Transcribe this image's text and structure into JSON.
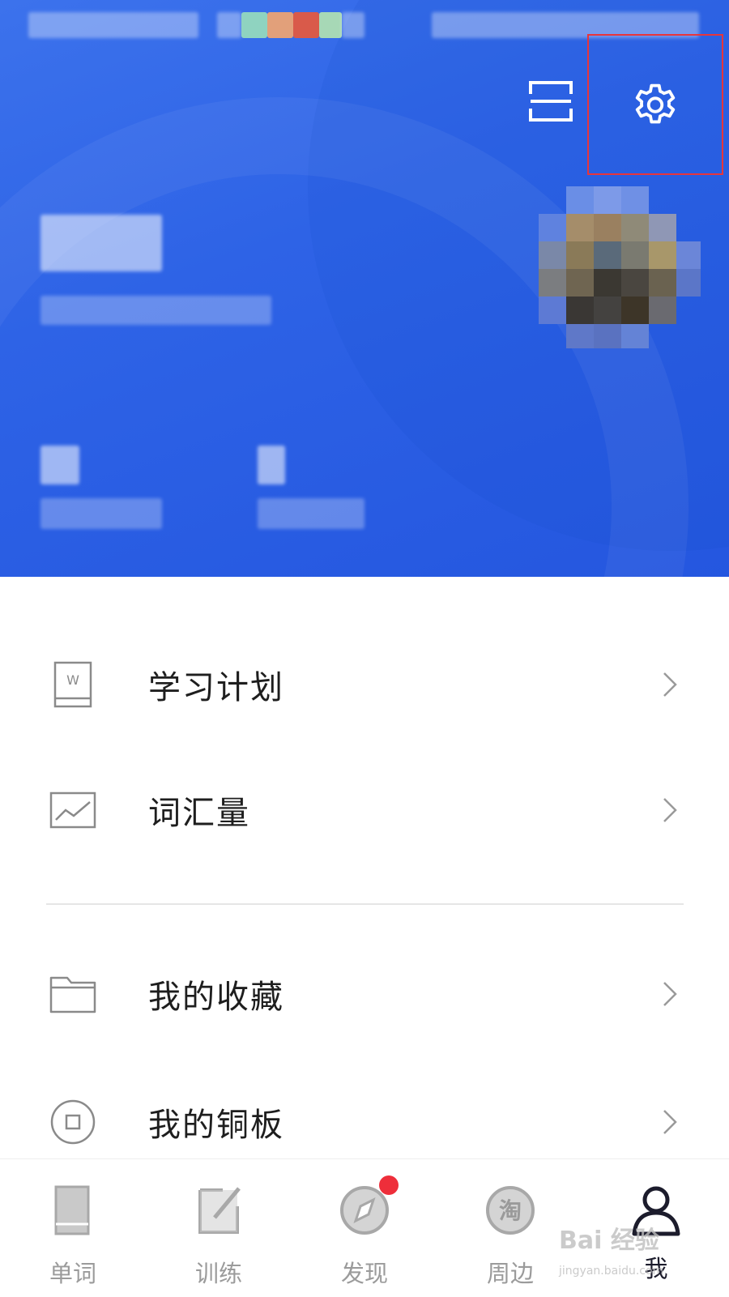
{
  "menu": {
    "items": [
      {
        "label": "学习计划",
        "icon": "book-w-icon"
      },
      {
        "label": "词汇量",
        "icon": "chart-icon"
      },
      {
        "label": "我的收藏",
        "icon": "folder-icon"
      },
      {
        "label": "我的铜板",
        "icon": "coin-icon"
      }
    ]
  },
  "nav": {
    "items": [
      {
        "label": "单词",
        "icon": "book-icon"
      },
      {
        "label": "训练",
        "icon": "edit-icon"
      },
      {
        "label": "发现",
        "icon": "compass-icon"
      },
      {
        "label": "周边",
        "icon": "tao-icon",
        "icon_text": "淘"
      },
      {
        "label": "我",
        "icon": "user-icon",
        "active": true
      }
    ]
  },
  "watermark": {
    "text": "Bai 经验",
    "sub": "jingyan.baidu.com"
  },
  "colors": {
    "header": "#2e63e6",
    "highlight": "#e8353b",
    "badge": "#ee2e3a",
    "active": "#1c1c2c",
    "inactive": "#9b9b9b"
  }
}
